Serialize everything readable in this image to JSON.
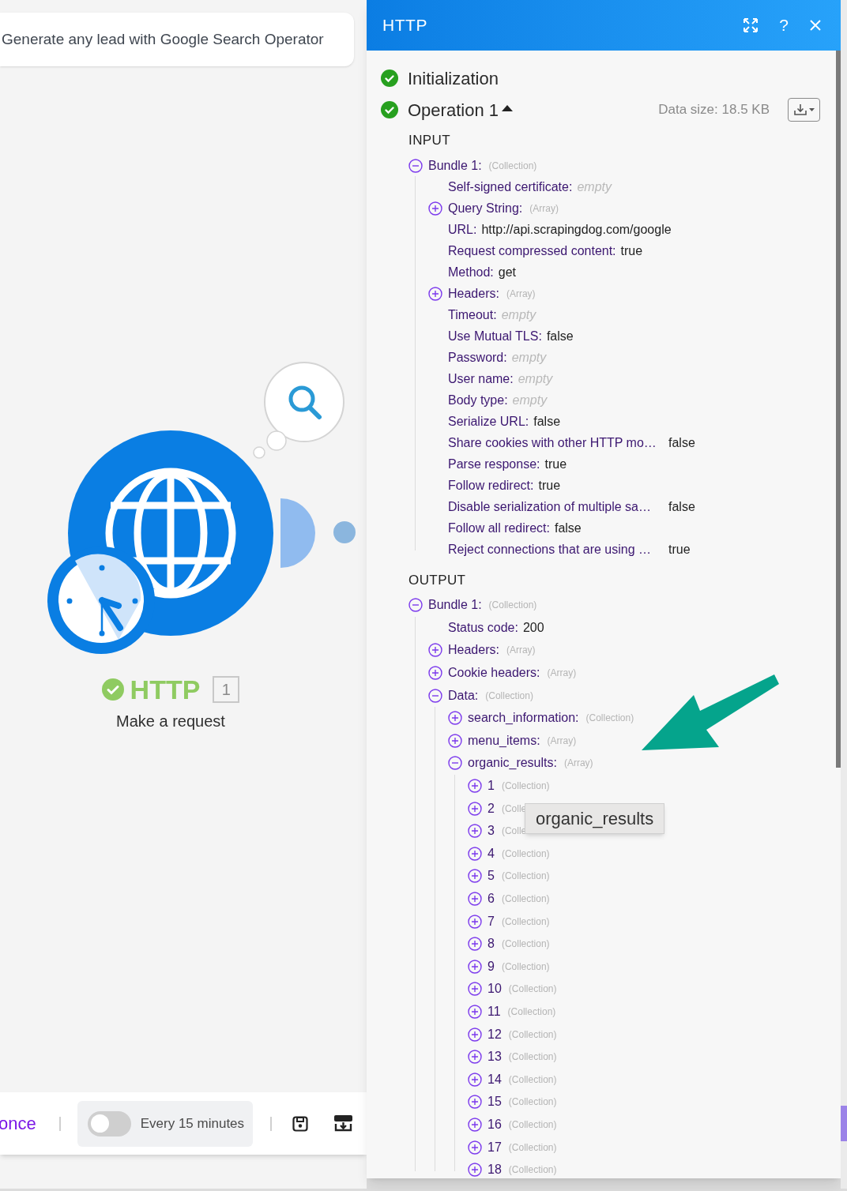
{
  "scenario": {
    "title": "Generate any lead with Google Search Operator"
  },
  "module": {
    "name": "HTTP",
    "count": "1",
    "subtitle": "Make a request"
  },
  "toolbar": {
    "run_label": "once",
    "schedule": {
      "on": false,
      "label": "Every 15 minutes"
    }
  },
  "panel": {
    "title": "HTTP",
    "help_label": "?",
    "steps": [
      {
        "label": "Initialization"
      },
      {
        "label": "Operation 1",
        "expanded": true,
        "data_size": "Data size: 18.5 KB"
      }
    ],
    "sections": [
      {
        "heading": "INPUT",
        "nodes": [
          {
            "label": "Bundle 1:",
            "note": "(Collection)",
            "expanded": true,
            "children": [
              {
                "label": "Self-signed certificate:",
                "value": "empty",
                "muted": true
              },
              {
                "label": "Query String:",
                "note": "(Array)",
                "expanded": false
              },
              {
                "label": "URL:",
                "value": "http://api.scrapingdog.com/google"
              },
              {
                "label": "Request compressed content:",
                "value": "true"
              },
              {
                "label": "Method:",
                "value": "get"
              },
              {
                "label": "Headers:",
                "note": "(Array)",
                "expanded": false
              },
              {
                "label": "Timeout:",
                "value": "empty",
                "muted": true
              },
              {
                "label": "Use Mutual TLS:",
                "value": "false"
              },
              {
                "label": "Password:",
                "value": "empty",
                "muted": true
              },
              {
                "label": "User name:",
                "value": "empty",
                "muted": true
              },
              {
                "label": "Body type:",
                "value": "empty",
                "muted": true
              },
              {
                "label": "Serialize URL:",
                "value": "false"
              },
              {
                "label": "Share cookies with other HTTP mo…",
                "value": "false",
                "clipped": true
              },
              {
                "label": "Parse response:",
                "value": "true"
              },
              {
                "label": "Follow redirect:",
                "value": "true"
              },
              {
                "label": "Disable serialization of multiple sa…",
                "value": "false",
                "clipped": true
              },
              {
                "label": "Follow all redirect:",
                "value": "false"
              },
              {
                "label": "Reject connections that are using …",
                "value": "true",
                "clipped": true
              }
            ]
          }
        ]
      },
      {
        "heading": "OUTPUT",
        "nodes": [
          {
            "label": "Bundle 1:",
            "note": "(Collection)",
            "expanded": true,
            "children": [
              {
                "label": "Status code:",
                "value": "200"
              },
              {
                "label": "Headers:",
                "note": "(Array)",
                "expanded": false
              },
              {
                "label": "Cookie headers:",
                "note": "(Array)",
                "expanded": false
              },
              {
                "label": "Data:",
                "note": "(Collection)",
                "expanded": true,
                "children": [
                  {
                    "label": "search_information:",
                    "note": "(Collection)",
                    "expanded": false
                  },
                  {
                    "label": "menu_items:",
                    "note": "(Array)",
                    "expanded": false
                  },
                  {
                    "label": "organic_results:",
                    "note": "(Array)",
                    "expanded": true,
                    "children": [
                      {
                        "label": "1",
                        "note": "(Collection)",
                        "expanded": false
                      },
                      {
                        "label": "2",
                        "note": "(Colle",
                        "expanded": false
                      },
                      {
                        "label": "3",
                        "note": "(Colle",
                        "expanded": false
                      },
                      {
                        "label": "4",
                        "note": "(Collection)",
                        "expanded": false
                      },
                      {
                        "label": "5",
                        "note": "(Collection)",
                        "expanded": false
                      },
                      {
                        "label": "6",
                        "note": "(Collection)",
                        "expanded": false
                      },
                      {
                        "label": "7",
                        "note": "(Collection)",
                        "expanded": false
                      },
                      {
                        "label": "8",
                        "note": "(Collection)",
                        "expanded": false
                      },
                      {
                        "label": "9",
                        "note": "(Collection)",
                        "expanded": false
                      },
                      {
                        "label": "10",
                        "note": "(Collection)",
                        "expanded": false
                      },
                      {
                        "label": "11",
                        "note": "(Collection)",
                        "expanded": false
                      },
                      {
                        "label": "12",
                        "note": "(Collection)",
                        "expanded": false
                      },
                      {
                        "label": "13",
                        "note": "(Collection)",
                        "expanded": false
                      },
                      {
                        "label": "14",
                        "note": "(Collection)",
                        "expanded": false
                      },
                      {
                        "label": "15",
                        "note": "(Collection)",
                        "expanded": false
                      },
                      {
                        "label": "16",
                        "note": "(Collection)",
                        "expanded": false
                      },
                      {
                        "label": "17",
                        "note": "(Collection)",
                        "expanded": false
                      },
                      {
                        "label": "18",
                        "note": "(Collection)",
                        "expanded": false
                      }
                    ]
                  }
                ]
              }
            ]
          }
        ]
      }
    ],
    "tooltip": "organic_results"
  }
}
